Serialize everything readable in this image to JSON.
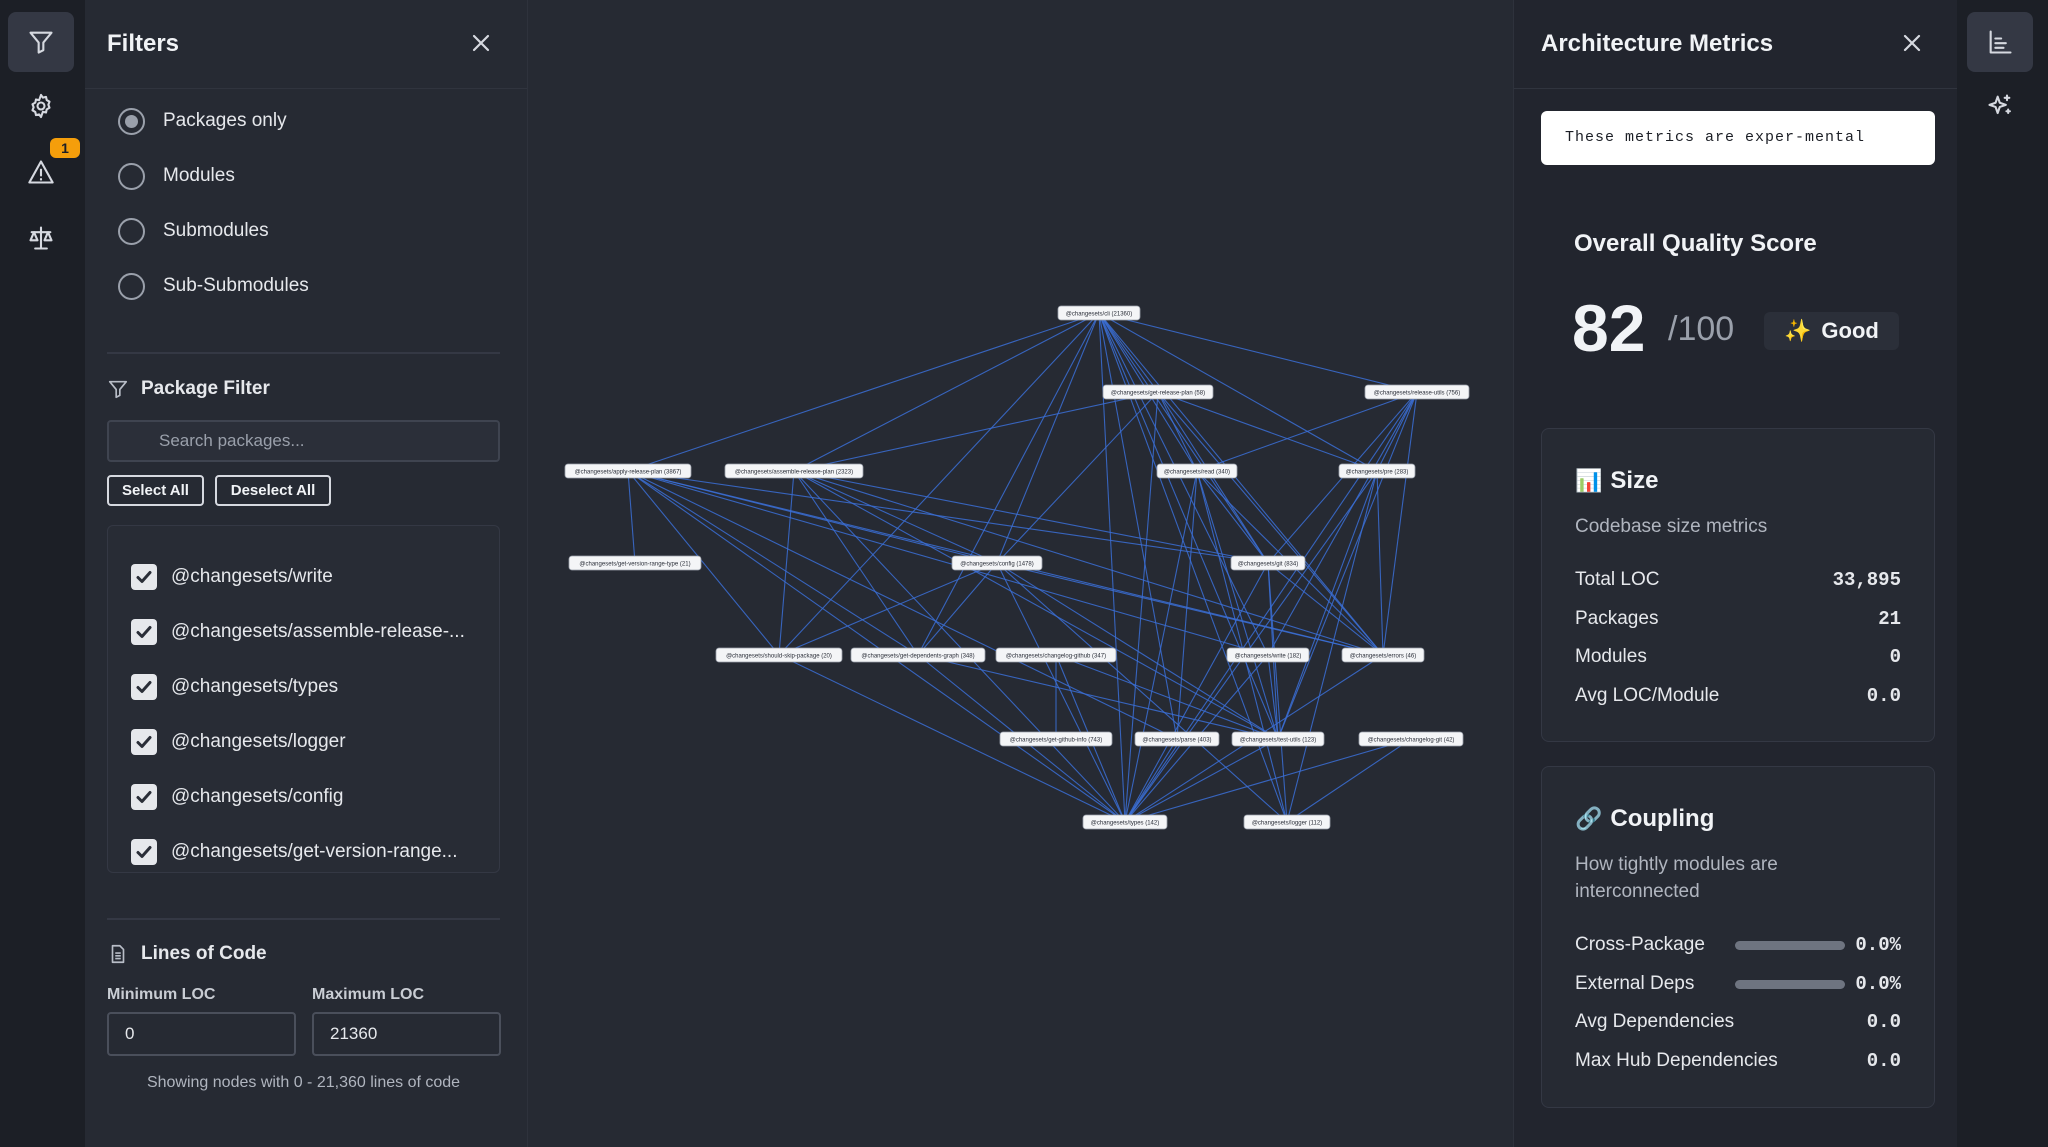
{
  "filters": {
    "title": "Filters",
    "levels": [
      {
        "label": "Packages only",
        "checked": true
      },
      {
        "label": "Modules",
        "checked": false
      },
      {
        "label": "Submodules",
        "checked": false
      },
      {
        "label": "Sub-Submodules",
        "checked": false
      }
    ],
    "package_filter": {
      "title": "Package Filter",
      "search_placeholder": "Search packages...",
      "select_all": "Select All",
      "deselect_all": "Deselect All",
      "packages": [
        "@changesets/write",
        "@changesets/assemble-release-...",
        "@changesets/types",
        "@changesets/logger",
        "@changesets/config",
        "@changesets/get-version-range..."
      ]
    },
    "loc": {
      "title": "Lines of Code",
      "min_label": "Minimum LOC",
      "max_label": "Maximum LOC",
      "min_value": "0",
      "max_value": "21360",
      "note": "Showing nodes with 0 - 21,360 lines of code"
    }
  },
  "rail": {
    "warning_count": "1"
  },
  "graph": {
    "nodes": [
      {
        "id": "cli",
        "label": "@changesets/cli (21360)"
      },
      {
        "id": "grp",
        "label": "@changesets/get-release-plan (58)"
      },
      {
        "id": "ru",
        "label": "@changesets/release-utils (756)"
      },
      {
        "id": "arp",
        "label": "@changesets/apply-release-plan (3867)"
      },
      {
        "id": "asm",
        "label": "@changesets/assemble-release-plan (2323)"
      },
      {
        "id": "read",
        "label": "@changesets/read (340)"
      },
      {
        "id": "pre",
        "label": "@changesets/pre (283)"
      },
      {
        "id": "gvr",
        "label": "@changesets/get-version-range-type (21)"
      },
      {
        "id": "cfg",
        "label": "@changesets/config (1478)"
      },
      {
        "id": "git",
        "label": "@changesets/git (834)"
      },
      {
        "id": "ssp",
        "label": "@changesets/should-skip-package (20)"
      },
      {
        "id": "gdg",
        "label": "@changesets/get-dependents-graph (348)"
      },
      {
        "id": "cgh",
        "label": "@changesets/changelog-github (347)"
      },
      {
        "id": "wr",
        "label": "@changesets/write (182)"
      },
      {
        "id": "err",
        "label": "@changesets/errors (46)"
      },
      {
        "id": "ghi",
        "label": "@changesets/get-github-info (743)"
      },
      {
        "id": "prs",
        "label": "@changesets/parse (403)"
      },
      {
        "id": "tu",
        "label": "@changesets/test-utils (123)"
      },
      {
        "id": "cgit",
        "label": "@changesets/changelog-git (42)"
      },
      {
        "id": "typ",
        "label": "@changesets/types (142)"
      },
      {
        "id": "log",
        "label": "@changesets/logger (112)"
      }
    ]
  },
  "metrics": {
    "title": "Architecture Metrics",
    "experimental_note": "These metrics are exper-mental",
    "score_title": "Overall Quality Score",
    "score": "82",
    "score_max": "/100",
    "score_badge_icon": "✨",
    "score_badge": "Good",
    "size": {
      "icon": "📊",
      "title": "Size",
      "subtitle": "Codebase size metrics",
      "rows": [
        {
          "k": "Total LOC",
          "v": "33,895"
        },
        {
          "k": "Packages",
          "v": "21"
        },
        {
          "k": "Modules",
          "v": "0"
        },
        {
          "k": "Avg LOC/Module",
          "v": "0.0"
        }
      ]
    },
    "coupling": {
      "icon": "🔗",
      "title": "Coupling",
      "subtitle": "How tightly modules are interconnected",
      "rows": [
        {
          "k": "Cross-Package",
          "v": "0.0%",
          "bar": 0.0
        },
        {
          "k": "External Deps",
          "v": "0.0%",
          "bar": 0.0
        },
        {
          "k": "Avg Dependencies",
          "v": "0.0"
        },
        {
          "k": "Max Hub Dependencies",
          "v": "0.0"
        }
      ]
    }
  }
}
